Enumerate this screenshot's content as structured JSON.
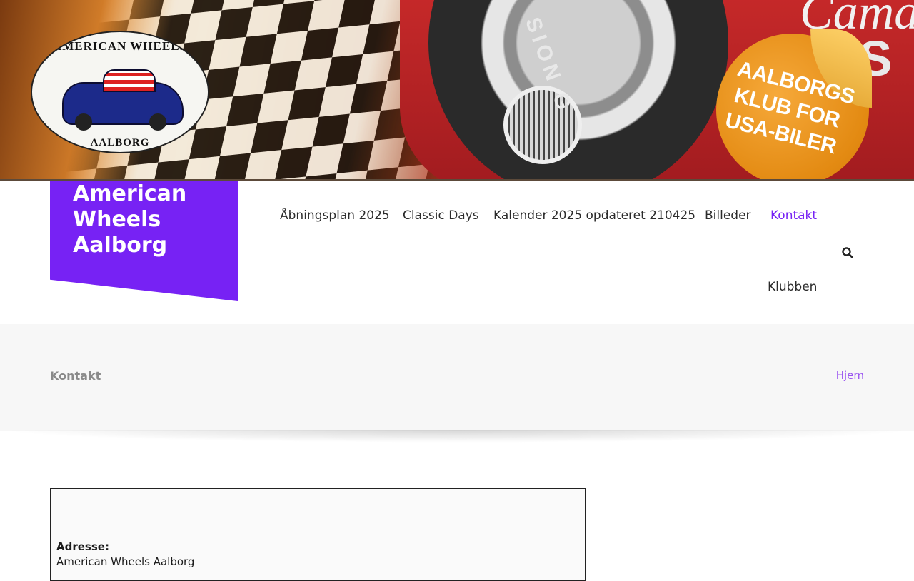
{
  "banner": {
    "logo_top_text": "AMERICAN WHEELS",
    "logo_bottom_text": "AALBORG",
    "tire_text": "SION G",
    "car_script": "Cama",
    "car_badge": "SS",
    "sticker_text": "AALBORGS KLUB FOR USA-BILER"
  },
  "site": {
    "title": "American Wheels Aalborg"
  },
  "nav": {
    "items": [
      {
        "label": "Åbningsplan 2025",
        "active": false
      },
      {
        "label": "Classic Days",
        "active": false
      },
      {
        "label": "Kalender 2025 opdateret 210425",
        "active": false
      },
      {
        "label": "Billeder",
        "active": false
      },
      {
        "label": "Kontakt",
        "active": true
      },
      {
        "label": "Klubben",
        "active": false
      }
    ],
    "search_icon": "search-icon"
  },
  "page": {
    "title": "Kontakt",
    "breadcrumb_home": "Hjem"
  },
  "content": {
    "address_label": "Adresse:",
    "address_line1": "American Wheels Aalborg"
  },
  "colors": {
    "accent": "#7722f4",
    "breadcrumb": "#9a55f0",
    "titlebar_bg": "#f7f7f7"
  }
}
